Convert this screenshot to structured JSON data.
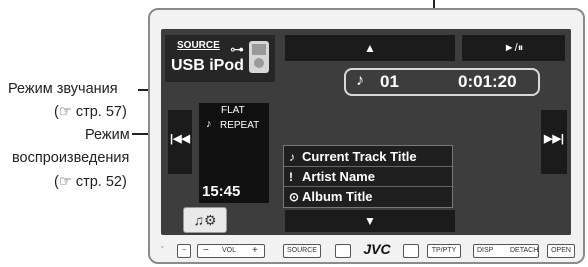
{
  "callouts": {
    "sound_mode": "Режим звучания",
    "sound_mode_ref": "(☞ стр. 57)",
    "playback_mode_line1": "Режим",
    "playback_mode_line2": "воспроизведения",
    "playback_mode_ref": "(☞ стр. 52)"
  },
  "source": {
    "label": "SOURCE",
    "name": "USB iPod"
  },
  "status": {
    "sound": "FLAT",
    "repeat": "REPEAT",
    "clock": "15:45"
  },
  "playback": {
    "track_number": "01",
    "time": "0:01:20"
  },
  "tracks": [
    {
      "icon": "♪",
      "title": "Current Track Title"
    },
    {
      "icon": "!",
      "title": "Artist Name"
    },
    {
      "icon": "⊙",
      "title": "Album Title"
    }
  ],
  "controls": {
    "up_arrow": "▲",
    "down_arrow": "▼",
    "play_pause": "►/⏸",
    "prev": "⏮",
    "next": "⏭"
  },
  "bottom_buttons": {
    "vol": "VOL",
    "minus": "−",
    "plus": "+",
    "source": "SOURCE",
    "brand": "JVC",
    "tp_pty": "TP/PTY",
    "disp": "DISP",
    "detach": "DETACH",
    "open": "OPEN"
  }
}
